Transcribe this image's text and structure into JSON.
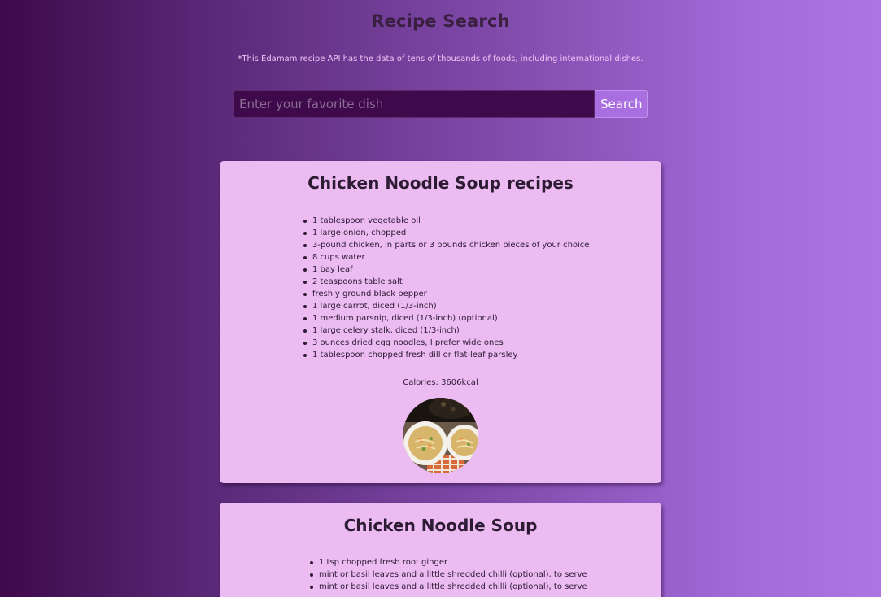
{
  "header": {
    "title": "Recipe Search",
    "note": "*This Edamam recipe API has the data of tens of thousands of foods, including international dishes."
  },
  "search": {
    "placeholder": "Enter your favorite dish",
    "value": "",
    "button_label": "Search"
  },
  "colors": {
    "background_left": "#3f0a4b",
    "background_right": "#ad74e2",
    "card": "#ebbbf2",
    "button": "#a96fe0",
    "input": "#3f0a4b"
  },
  "recipes": [
    {
      "title": "Chicken Noodle Soup recipes",
      "ingredients": [
        "1 tablespoon vegetable oil",
        "1 large onion, chopped",
        "3-pound chicken, in parts or 3 pounds chicken pieces of your choice",
        "8 cups water",
        "1 bay leaf",
        "2 teaspoons table salt",
        "freshly ground black pepper",
        "1 large carrot, diced (1/3-inch)",
        "1 medium parsnip, diced (1/3-inch) (optional)",
        "1 large celery stalk, diced (1/3-inch)",
        "3 ounces dried egg noodles, I prefer wide ones",
        "1 tablespoon chopped fresh dill or flat-leaf parsley"
      ],
      "calories": "Calories: 3606kcal",
      "image": "soup-bowls-photo"
    },
    {
      "title": "Chicken Noodle Soup",
      "ingredients": [
        "1 tsp chopped fresh root ginger",
        "mint or basil leaves and a little shredded chilli (optional), to serve",
        "mint or basil leaves and a little shredded chilli (optional), to serve"
      ]
    }
  ]
}
